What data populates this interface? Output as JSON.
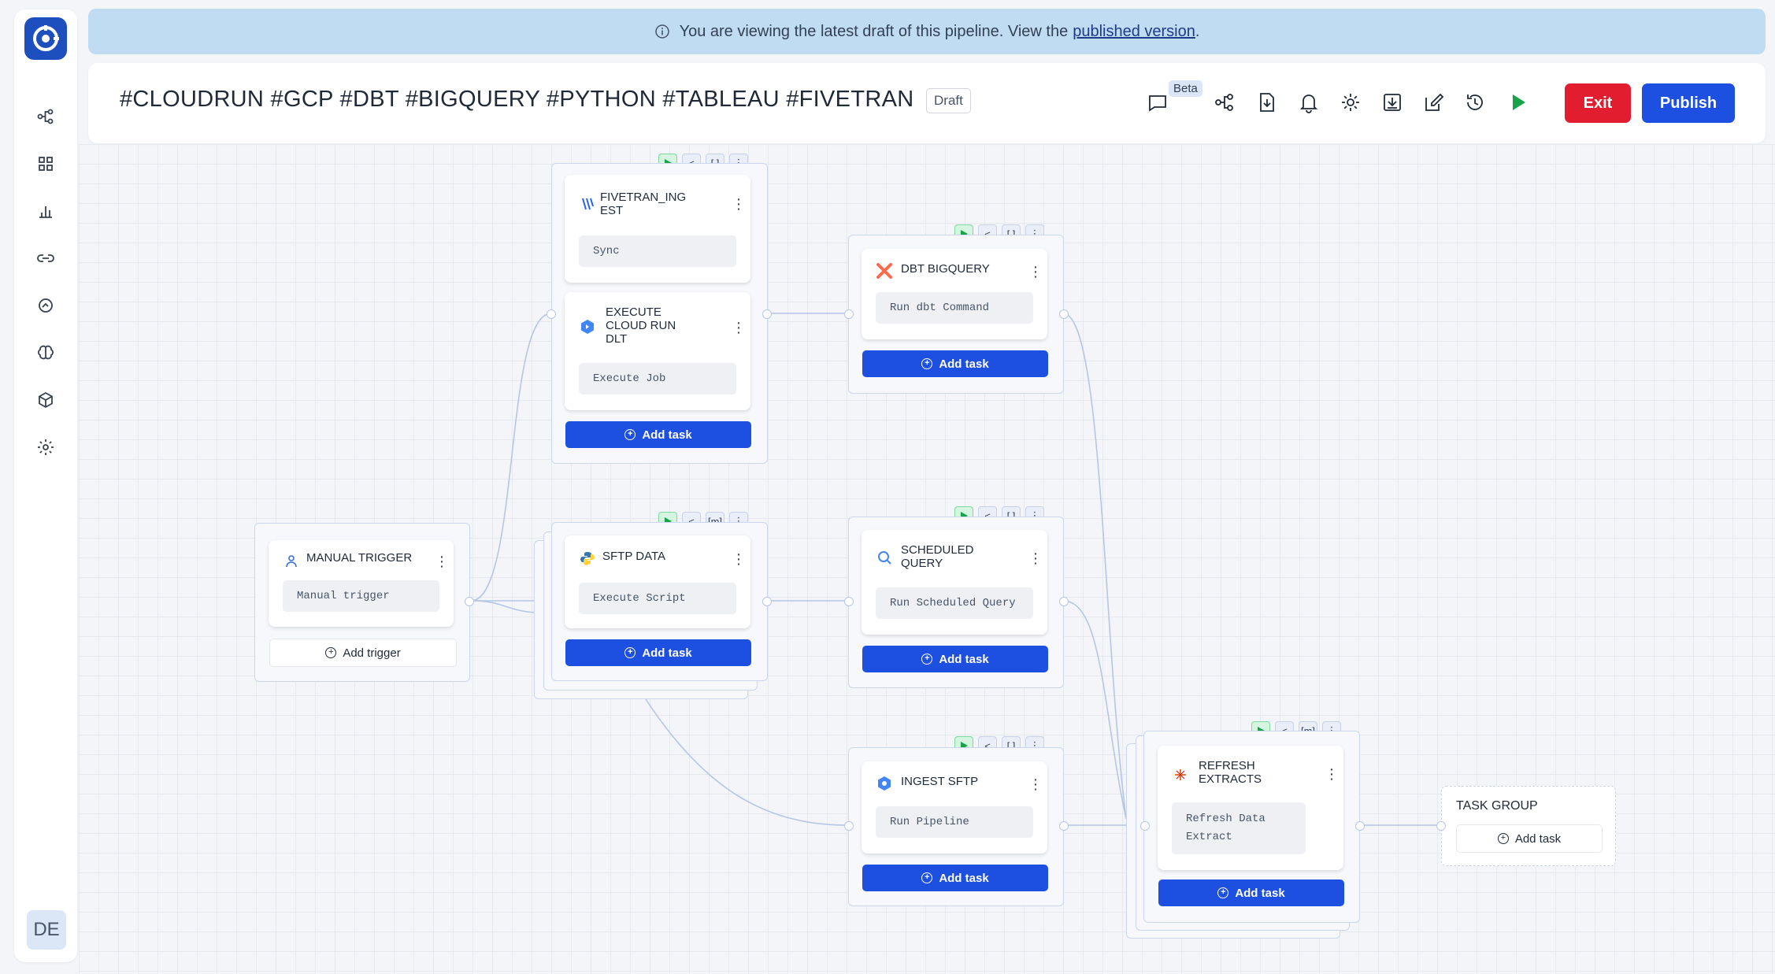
{
  "banner": {
    "text": "You are viewing the latest draft of this pipeline. View the",
    "link": "published version",
    "suffix": "."
  },
  "header": {
    "title": "#CLOUDRUN #GCP #DBT #BIGQUERY #PYTHON #TABLEAU #FIVETRAN",
    "status": "Draft",
    "beta": "Beta",
    "exit_label": "Exit",
    "publish_label": "Publish"
  },
  "sidebar": {
    "avatar": "DE"
  },
  "colors": {
    "primary": "#1d4fe0",
    "danger": "#e11d2f",
    "banner": "#bfdcf2",
    "run": "#16a34a"
  },
  "nodes": {
    "trigger": {
      "title": "MANUAL TRIGGER",
      "field": "Manual trigger",
      "button": "Add trigger"
    },
    "fivetran": {
      "title": "FIVETRAN_ING EST",
      "field": "Sync"
    },
    "cloudrun": {
      "title": "EXECUTE CLOUD RUN DLT",
      "field": "Execute Job",
      "button": "Add task"
    },
    "sftp_data": {
      "title": "SFTP DATA",
      "field": "Execute Script",
      "button": "Add task"
    },
    "dbt": {
      "title": "DBT BIGQUERY",
      "field": "Run dbt Command",
      "button": "Add task"
    },
    "scheduled": {
      "title": "SCHEDULED QUERY",
      "field": "Run Scheduled Query",
      "button": "Add task"
    },
    "ingest": {
      "title": "INGEST SFTP",
      "field": "Run Pipeline",
      "button": "Add task"
    },
    "refresh": {
      "title": "REFRESH EXTRACTS",
      "field": "Refresh Data Extract",
      "button": "Add task"
    },
    "task_group": {
      "title": "TASK GROUP",
      "button": "Add task"
    }
  }
}
